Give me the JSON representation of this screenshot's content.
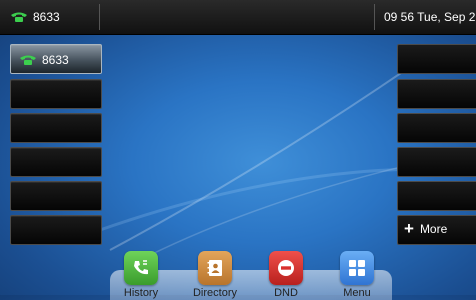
{
  "status_bar": {
    "line_number": "8633",
    "clock": "09 56 Tue, Sep 2"
  },
  "line_keys": [
    {
      "label": "8633",
      "active": true
    },
    {
      "label": ""
    },
    {
      "label": ""
    },
    {
      "label": ""
    },
    {
      "label": ""
    },
    {
      "label": ""
    }
  ],
  "right_keys": [
    {
      "label": ""
    },
    {
      "label": ""
    },
    {
      "label": ""
    },
    {
      "label": ""
    },
    {
      "label": ""
    },
    {
      "label": "More",
      "icon": "plus-icon"
    }
  ],
  "dock": [
    {
      "label": "History",
      "icon": "history-icon",
      "color": "#4caf3c"
    },
    {
      "label": "Directory",
      "icon": "directory-icon",
      "color": "#c8873a"
    },
    {
      "label": "DND",
      "icon": "dnd-icon",
      "color": "#d9302c"
    },
    {
      "label": "Menu",
      "icon": "menu-icon",
      "color": "#3f8ee8"
    }
  ]
}
